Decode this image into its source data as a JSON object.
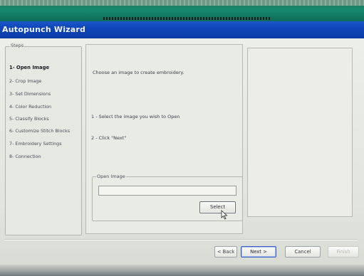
{
  "window": {
    "title": "Autopunch Wizard"
  },
  "steps": {
    "legend": "Steps",
    "items": [
      {
        "label": "1- Open Image",
        "active": true
      },
      {
        "label": "2- Crop Image",
        "active": false
      },
      {
        "label": "3- Set Dimensions",
        "active": false
      },
      {
        "label": "4- Color Reduction",
        "active": false
      },
      {
        "label": "5- Classify Blocks",
        "active": false
      },
      {
        "label": "6- Customize Stitch Blocks",
        "active": false
      },
      {
        "label": "7- Embroidery Settings",
        "active": false
      },
      {
        "label": "8- Connection",
        "active": false
      }
    ]
  },
  "content": {
    "intro": "Choose an image to create embroidery.",
    "instruction_1": "1 - Select the image you wish to Open",
    "instruction_2": "2 - Click \"Next\"",
    "open_image": {
      "legend": "Open Image",
      "path_value": "",
      "select_label": "Select"
    }
  },
  "buttons": {
    "back": "< Back",
    "next": "Next >",
    "cancel": "Cancel",
    "finish": "Finish"
  },
  "colors": {
    "titlebar": "#0f45b8",
    "window_bg": "#e2e4de"
  }
}
